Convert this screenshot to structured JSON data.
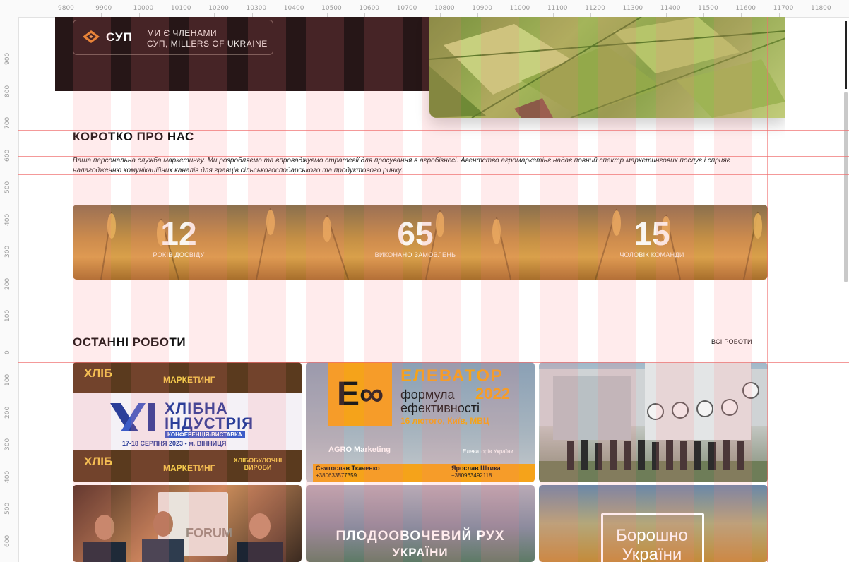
{
  "ruler": {
    "top": [
      "9800",
      "9900",
      "10000",
      "10100",
      "10200",
      "10300",
      "10400",
      "10500",
      "10600",
      "10700",
      "10800",
      "10900",
      "11000",
      "11100",
      "11200",
      "11300",
      "11400",
      "11500",
      "11600",
      "11700",
      "11800"
    ],
    "left": [
      "900",
      "800",
      "700",
      "600",
      "500",
      "400",
      "300",
      "200",
      "100",
      "0",
      "100",
      "200",
      "300",
      "400",
      "500",
      "600"
    ]
  },
  "badge": {
    "brand": "СУП",
    "line1": "МИ Є ЧЛЕНАМИ",
    "line2": "СУП, MILLERS OF UKRAINE"
  },
  "about": {
    "title": "КОРОТКО ПРО НАС",
    "text": "Ваша персональна служба маркетингу. Ми розробляємо та впроваджуємо стратегії для просування в агробізнесі. Агентство агромаркетінг надає повний спектр маркетингових послуг і сприяє налагодженню комунікаційних каналів для гравців сільськогосподарського та продуктового ринку."
  },
  "stats": [
    {
      "value": "12",
      "label": "РОКІВ ДОСВІДУ"
    },
    {
      "value": "65",
      "label": "ВИКОНАНО ЗАМОВЛЕНЬ"
    },
    {
      "value": "15",
      "label": "ЧОЛОВІК КОМАНДИ"
    }
  ],
  "works": {
    "title": "ОСТАННІ РОБОТИ",
    "all_link": "ВСІ РОБОТИ",
    "cards": [
      {
        "line1": "ХЛІБНА",
        "line2": "ІНДУСТРІЯ",
        "line3": "КОНФЕРЕНЦІЯ-ВИСТАВКА",
        "date": "17-18 СЕРПНЯ 2023 • м. ВІННИЦЯ",
        "banner": "ХЛІБ",
        "banner2": "МАРКЕТИНГ",
        "banner3": "ХЛІБОБУЛОЧНІ ВИРОБИ"
      },
      {
        "brand": "ЕЛЕВАТОР",
        "year": "2022",
        "sub1": "формула",
        "sub2": "ефективності",
        "date": "16 лютого, Київ, МВЦ",
        "agency": "AGRO Marketing",
        "partner": "Елеваторів України",
        "contact1": "Святослав Ткаченко",
        "phone1": "+380633577359",
        "contact2": "Ярослав Штика",
        "phone2": "+380963492118"
      },
      {},
      {
        "sign": "FORUM"
      },
      {
        "line1": "ПЛОДООВОЧЕВИЙ РУХ",
        "line2": "УКРАЇНИ"
      },
      {
        "line1": "Борошно",
        "line2": "України"
      }
    ]
  }
}
